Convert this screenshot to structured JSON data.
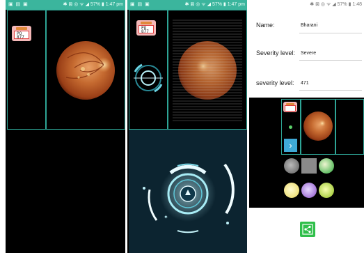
{
  "status_bar": {
    "panel1_left": "▣ ▤ ▣",
    "panel1_right": "✱ ⊠ ◎ ᯤ ◢ 57% ▮ 1:47 pm",
    "panel2_left": "▣ ▤ ▣",
    "panel2_right": "✱ ⊠ ◎ ᯤ ◢ 57% ▮ 1:47 pm",
    "panel3_right": "✱ ⊠ ◎ ᯤ ◢ 57% ▮ 1:48"
  },
  "device_badge_text": "PO\n877",
  "form": {
    "name_label": "Name:",
    "name_value": "Bharani",
    "severity_label": "Severity level:",
    "severity_value": "Severe",
    "severity_level_label": "severity level:",
    "severity_level_value": "471"
  },
  "colors": {
    "accent": "#2ea596",
    "statusbar": "#3bb59d",
    "share": "#2fbf4a"
  },
  "icons": {
    "scanner": "circular-scanner-icon",
    "share": "share-icon",
    "arrow": "arrow-right-icon"
  }
}
